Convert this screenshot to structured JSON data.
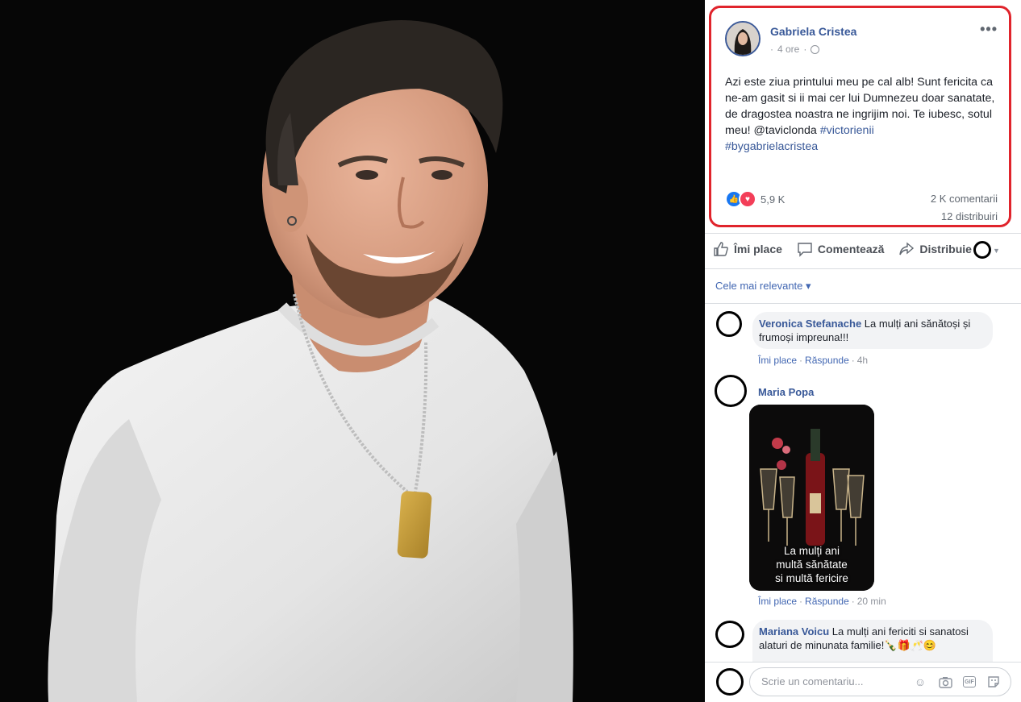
{
  "post": {
    "author": "Gabriela Cristea",
    "time": "4 ore",
    "dot": "·",
    "text_main": "Azi este ziua printului meu pe cal alb! Sunt fericita ca ne-am gasit si ii mai cer lui Dumnezeu doar sanatate, de dragostea noastra ne ingrijim noi. Te iubesc, sotul meu! @taviclonda ",
    "hashtag1": "#victorienii",
    "hashtag2": "#bygabrielacristea",
    "reactions_count": "5,9 K",
    "comments_count": "2 K comentarii",
    "shares_count": "12 distribuiri",
    "more_label": "•••"
  },
  "actions": {
    "like": "Îmi place",
    "comment": "Comentează",
    "share": "Distribuie"
  },
  "sort_label": "Cele mai relevante ▾",
  "comments": [
    {
      "author": "Veronica Stefanache",
      "text": " La mulți ani sănătoși și frumoși impreuna!!!",
      "like": "Îmi place",
      "reply": "Răspunde",
      "sep": "·",
      "time": "4h"
    },
    {
      "author": "Maria Popa",
      "like": "Îmi place",
      "reply": "Răspunde",
      "sep": "·",
      "time": "20 min",
      "gif_caption": [
        "La mulți ani",
        "multă sănătate",
        "si multă fericire"
      ]
    },
    {
      "author": "Mariana Voicu",
      "text": " La mulți ani fericiti si sanatosi alaturi de minunata familie!🍾🎁🥂😊"
    }
  ],
  "composer": {
    "placeholder": "Scrie un comentariu...",
    "gif_label": "GIF"
  },
  "colors": {
    "brand_link": "#385898",
    "highlight_border": "#e0242c",
    "like_blue": "#1877f2",
    "love_red": "#f33e58"
  }
}
